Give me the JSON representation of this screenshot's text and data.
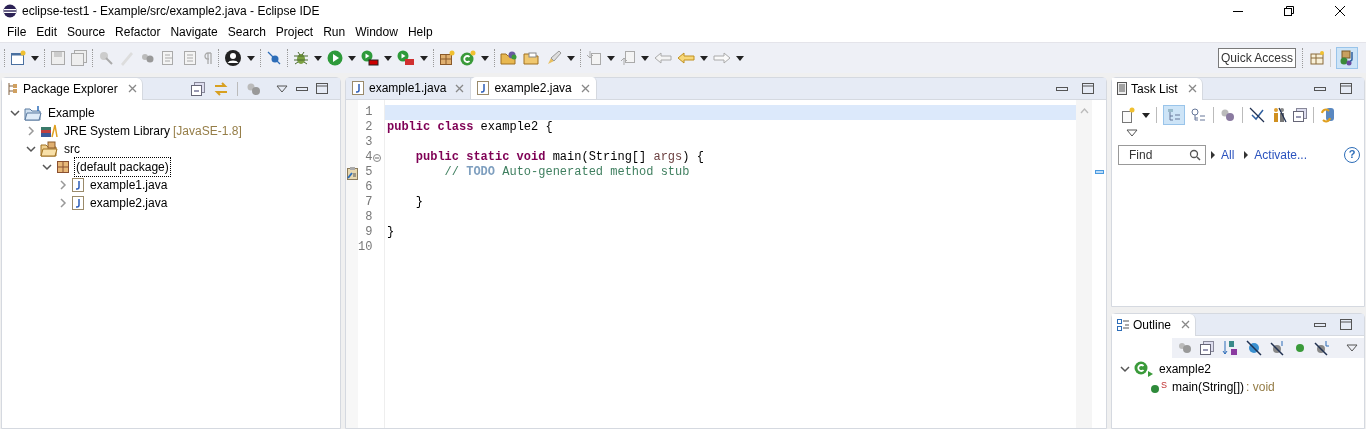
{
  "window": {
    "title": "eclipse-test1 - Example/src/example2.java - Eclipse IDE"
  },
  "menu": [
    "File",
    "Edit",
    "Source",
    "Refactor",
    "Navigate",
    "Search",
    "Project",
    "Run",
    "Window",
    "Help"
  ],
  "quick_access": {
    "placeholder": "Quick Access"
  },
  "package_explorer": {
    "title": "Package Explorer",
    "tree": [
      {
        "label": "Example",
        "kind": "project",
        "expanded": true,
        "selected": false,
        "children": [
          {
            "label": "JRE System Library",
            "decoration": "[JavaSE-1.8]",
            "kind": "library",
            "expanded": false,
            "selected": false
          },
          {
            "label": "src",
            "kind": "folder",
            "expanded": true,
            "selected": false,
            "children": [
              {
                "label": "(default package)",
                "kind": "package",
                "expanded": true,
                "selected": true,
                "children": [
                  {
                    "label": "example1.java",
                    "kind": "file",
                    "expanded": false,
                    "selected": false
                  },
                  {
                    "label": "example2.java",
                    "kind": "file",
                    "expanded": false,
                    "selected": false
                  }
                ]
              }
            ]
          }
        ]
      }
    ]
  },
  "editor": {
    "tabs": [
      {
        "label": "example1.java",
        "selected": false
      },
      {
        "label": "example2.java",
        "selected": true
      }
    ],
    "lines": [
      {
        "number": "1",
        "current": true
      },
      {
        "number": "2",
        "current": false,
        "tokens": [
          {
            "kind": "keyword",
            "text": "public class"
          },
          {
            "kind": "plain",
            "text": " example2 {"
          }
        ]
      },
      {
        "number": "3",
        "current": false
      },
      {
        "number": "4",
        "current": false,
        "fold": true,
        "tokens": [
          {
            "kind": "keyword",
            "text": "    public static void"
          },
          {
            "kind": "plain",
            "text": " main(String[] "
          },
          {
            "kind": "parameter",
            "text": "args"
          },
          {
            "kind": "plain",
            "text": ") {"
          }
        ]
      },
      {
        "number": "5",
        "current": false,
        "task_marker": true,
        "tokens": [
          {
            "kind": "comment",
            "text": "        // "
          },
          {
            "kind": "todo",
            "text": "TODO"
          },
          {
            "kind": "comment",
            "text": " Auto-generated method stub"
          }
        ]
      },
      {
        "number": "6",
        "current": false
      },
      {
        "number": "7",
        "current": false,
        "tokens": [
          {
            "kind": "plain",
            "text": "    }"
          }
        ]
      },
      {
        "number": "8",
        "current": false
      },
      {
        "number": "9",
        "current": false,
        "tokens": [
          {
            "kind": "plain",
            "text": "}"
          }
        ]
      },
      {
        "number": "10",
        "current": false
      }
    ]
  },
  "task_list": {
    "title": "Task List",
    "find": {
      "placeholder": "Find"
    },
    "links": [
      "All",
      "Activate..."
    ],
    "help": "?"
  },
  "outline": {
    "title": "Outline",
    "tree": [
      {
        "label": "example2",
        "kind": "class",
        "expanded": true,
        "children": [
          {
            "label": "main(String[])",
            "modifier": "S",
            "return_type": ": void",
            "kind": "method"
          }
        ]
      }
    ]
  }
}
